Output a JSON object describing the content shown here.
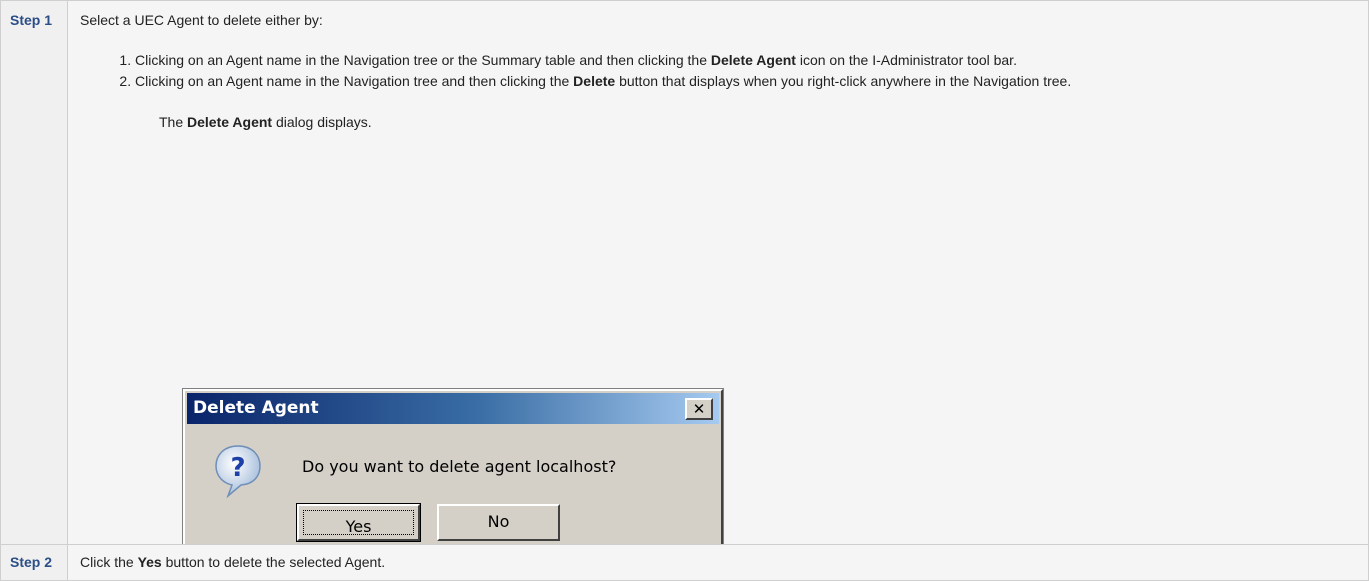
{
  "step1": {
    "label": "Step 1",
    "intro": "Select a UEC Agent to delete either by:",
    "methods": [
      {
        "before": "Clicking on an Agent name in the Navigation tree or the Summary table and then clicking the ",
        "bold": "Delete Agent",
        "after": " icon on the I-Administrator tool bar."
      },
      {
        "before": "Clicking on an Agent name in the Navigation tree and then clicking the ",
        "bold": "Delete",
        "after": " button that displays when you right-click anywhere in the Navigation tree."
      }
    ],
    "result": {
      "before": "The ",
      "bold": "Delete Agent",
      "after": " dialog displays."
    }
  },
  "dialog": {
    "title": "Delete Agent",
    "close_glyph": "✕",
    "icon": "question-icon",
    "message": "Do you want to delete agent localhost?",
    "yes_label": "Yes",
    "no_label": "No"
  },
  "step2": {
    "label": "Step 2",
    "before": "Click the ",
    "bold": "Yes",
    "after": " button to delete the selected Agent."
  },
  "colors": {
    "step_label": "#2b4e86",
    "cell_background": "#f5f5f5",
    "dialog_face": "#d4d0c8",
    "titlebar_start": "#0a246a",
    "titlebar_end": "#a6caf0"
  }
}
